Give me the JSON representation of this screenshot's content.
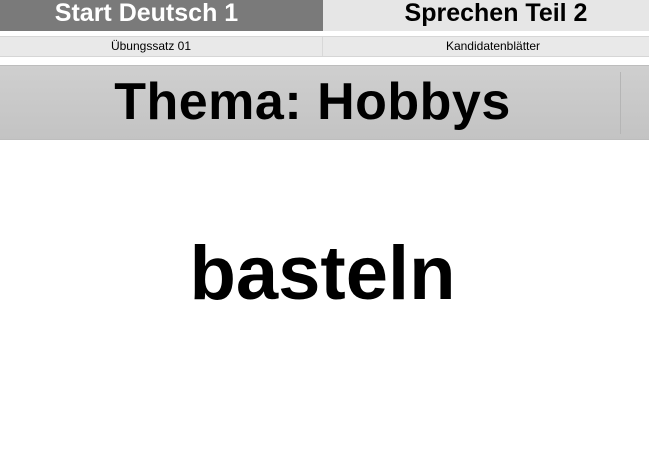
{
  "header": {
    "exam_title": "Start Deutsch 1",
    "section_title": "Sprechen Teil 2",
    "exercise_set": "Übungssatz 01",
    "sheet_type": "Kandidatenblätter"
  },
  "card": {
    "theme": "Thema: Hobbys",
    "word": "basteln"
  },
  "colors": {
    "left_header_bg": "#7a7a7a",
    "right_header_bg": "#e6e6e6",
    "theme_band_bg": "#c9c9c9",
    "text": "#000000"
  }
}
